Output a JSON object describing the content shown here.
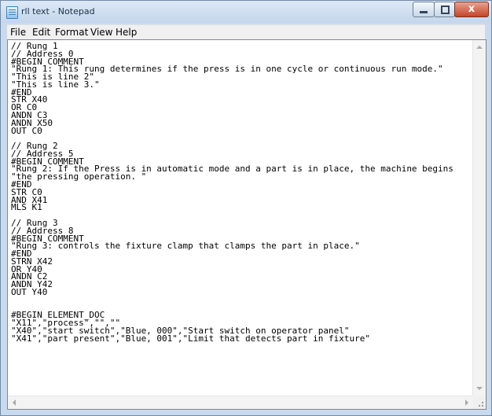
{
  "window": {
    "title": "rll text - Notepad",
    "buttons": {
      "close_glyph": "x"
    },
    "icon": "notepad-icon"
  },
  "menu": [
    {
      "label": "File"
    },
    {
      "label": "Edit"
    },
    {
      "label": "Format"
    },
    {
      "label": "View"
    },
    {
      "label": "Help"
    }
  ],
  "editor": {
    "lines": [
      "// Rung 1",
      "// Address 0",
      "#BEGIN COMMENT",
      "\"Rung 1: This rung determines if the press is in one cycle or continuous run mode.\"",
      "\"This is line 2\"",
      "\"This is line 3.\"",
      "#END",
      "STR X40",
      "OR C0",
      "ANDN C3",
      "ANDN X50",
      "OUT C0",
      "",
      "// Rung 2",
      "// Address 5",
      "#BEGIN COMMENT",
      "\"Rung 2: If the Press is in automatic mode and a part is in place, the machine begins",
      "\"the pressing operation. \"",
      "#END",
      "STR C0",
      "AND X41",
      "MLS K1",
      "",
      "// Rung 3",
      "// Address 8",
      "#BEGIN COMMENT",
      "\"Rung 3: controls the fixture clamp that clamps the part in place.\"",
      "#END",
      "STRN X42",
      "OR Y40",
      "ANDN C2",
      "ANDN Y42",
      "OUT Y40",
      "",
      "",
      "#BEGIN ELEMENT_DOC",
      "\"X11\",\"process\",\"\",\"\"",
      "\"X40\",\"start switch\",\"Blue, 000\",\"Start switch on operator panel\"",
      "\"X41\",\"part present\",\"Blue, 001\",\"Limit that detects part in fixture\""
    ]
  }
}
